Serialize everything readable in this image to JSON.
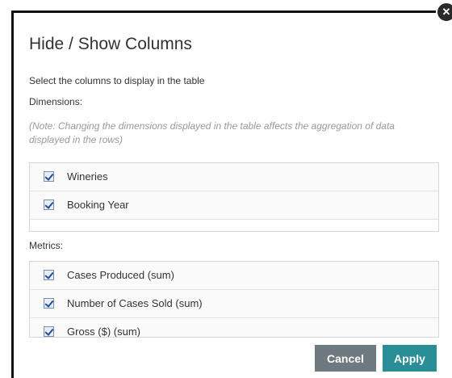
{
  "dialog": {
    "title": "Hide / Show Columns",
    "subtitle": "Select the columns to display in the table",
    "close_glyph": "✕",
    "dimensions_label": "Dimensions:",
    "note": "(Note: Changing the dimensions displayed in the table affects the aggregation of data displayed in the rows)",
    "dimensions": [
      {
        "label": "Wineries",
        "checked": true
      },
      {
        "label": "Booking Year",
        "checked": true
      }
    ],
    "metrics_label": "Metrics:",
    "metrics": [
      {
        "label": "Cases Produced (sum)",
        "checked": true
      },
      {
        "label": "Number of Cases Sold (sum)",
        "checked": true
      },
      {
        "label": "Gross ($) (sum)",
        "checked": true
      }
    ],
    "cancel_label": "Cancel",
    "apply_label": "Apply"
  },
  "colors": {
    "cancel_button": "#6f7a80",
    "apply_button": "#2a8e96",
    "note_text": "#999999"
  }
}
